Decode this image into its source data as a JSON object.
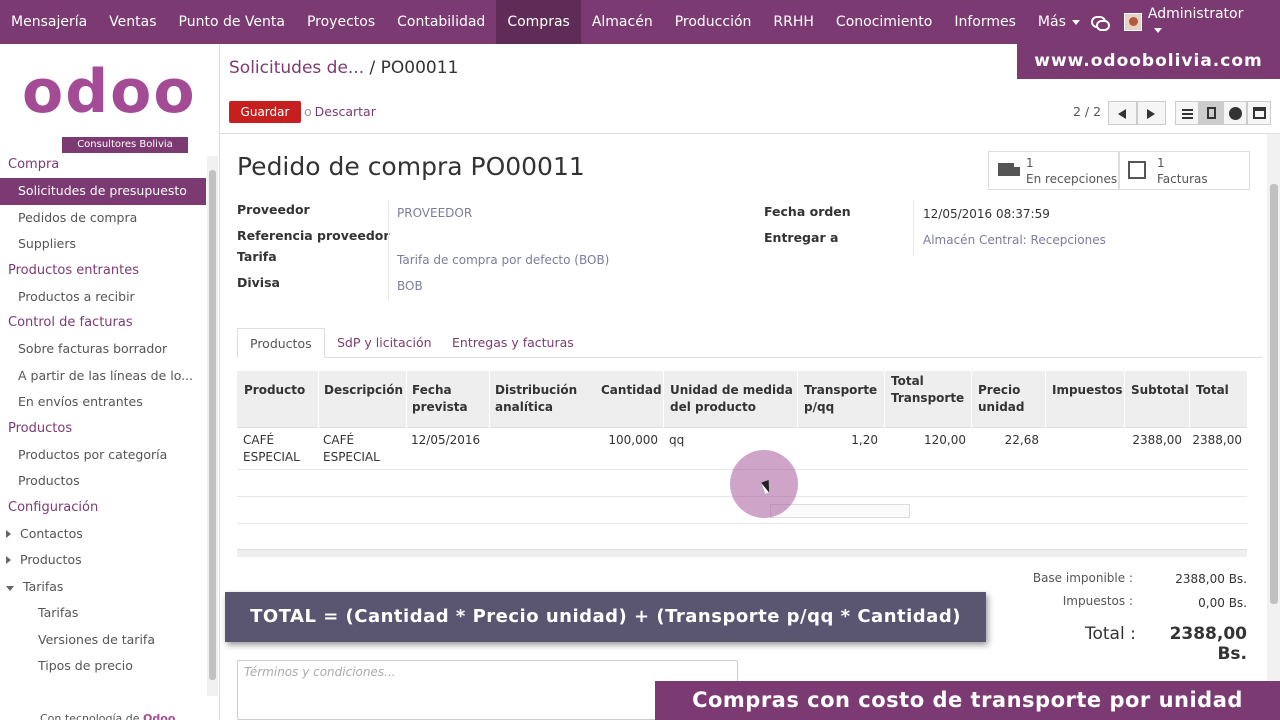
{
  "topnav": {
    "items": [
      "Mensajería",
      "Ventas",
      "Punto de Venta",
      "Proyectos",
      "Contabilidad",
      "Compras",
      "Almacén",
      "Producción",
      "RRHH",
      "Conocimiento",
      "Informes",
      "Más"
    ],
    "active": "Compras",
    "user": "Administrator"
  },
  "logo": {
    "word": "odoo",
    "subtitle": "Consultores Bolivia"
  },
  "sidebar": {
    "sections": [
      {
        "title": "Compra",
        "items": [
          "Solicitudes de presupuesto",
          "Pedidos de compra",
          "Suppliers"
        ]
      },
      {
        "title": "Productos entrantes",
        "items": [
          "Productos a recibir"
        ]
      },
      {
        "title": "Control de facturas",
        "items": [
          "Sobre facturas borrador",
          "A partir de las líneas de lo...",
          "En envíos entrantes"
        ]
      },
      {
        "title": "Productos",
        "items": [
          "Productos por categoría",
          "Productos"
        ]
      },
      {
        "title": "Configuración",
        "items": [
          "Contactos",
          "Productos",
          "Tarifas",
          "Tarifas",
          "Versiones de tarifa",
          "Tipos de precio"
        ]
      }
    ],
    "active_item": "Solicitudes de presupuesto",
    "powered_prefix": "Con tecnología de",
    "powered_brand": "Odoo"
  },
  "breadcrumb": {
    "parent": "Solicitudes de...",
    "separator": "/",
    "current": "PO00011"
  },
  "buttons": {
    "save": "Guardar",
    "or": "o",
    "discard": "Descartar"
  },
  "pager": {
    "text": "2 / 2"
  },
  "banners": {
    "site": "www.odoobolivia.com",
    "bottom": "Compras con costo de transporte por unidad",
    "formula": "TOTAL = (Cantidad * Precio unidad) + (Transporte p/qq * Cantidad)"
  },
  "form": {
    "title": "Pedido de compra PO00011",
    "smart_buttons": [
      {
        "count": "1",
        "label": "En recepciones",
        "icon": "truck-icon"
      },
      {
        "count": "1",
        "label": "Facturas",
        "icon": "edit-icon"
      }
    ],
    "left_fields": {
      "proveedor_label": "Proveedor",
      "proveedor_value": "PROVEEDOR",
      "referencia_label": "Referencia proveedor",
      "tarifa_label": "Tarifa",
      "tarifa_value": "Tarifa de compra por defecto (BOB)",
      "divisa_label": "Divisa",
      "divisa_value": "BOB"
    },
    "right_fields": {
      "fecha_label": "Fecha orden",
      "fecha_value": "12/05/2016 08:37:59",
      "entregar_label": "Entregar a",
      "entregar_value": "Almacén Central: Recepciones"
    },
    "tabs": [
      "Productos",
      "SdP y licitación",
      "Entregas y facturas"
    ],
    "table": {
      "headers": {
        "producto": "Producto",
        "descripcion": "Descripción",
        "fecha1": "Fecha",
        "fecha2": "prevista",
        "dist1": "Distribución",
        "dist2": "analítica",
        "cantidad": "Cantidad",
        "uom1": "Unidad de medida",
        "uom2": "del producto",
        "transp1": "Transporte",
        "transp2": "p/qq",
        "ttransp1": "Total",
        "ttransp2": "Transporte",
        "precio1": "Precio",
        "precio2": "unidad",
        "impuestos": "Impuestos",
        "subtotal": "Subtotal",
        "total": "Total"
      },
      "row": {
        "producto1": "CAFÉ",
        "producto2": "ESPECIAL",
        "descripcion1": "CAFÉ",
        "descripcion2": "ESPECIAL",
        "fecha": "12/05/2016",
        "cantidad": "100,000",
        "uom": "qq",
        "transporte": "1,20",
        "total_transporte": "120,00",
        "precio": "22,68",
        "subtotal": "2388,00",
        "total": "2388,00"
      }
    },
    "totals": {
      "base_label": "Base imponible :",
      "base_value": "2388,00 Bs.",
      "impuestos_label": "Impuestos :",
      "impuestos_value": "0,00 Bs.",
      "total_label": "Total :",
      "total_value": "2388,00 Bs."
    },
    "terms_placeholder": "Términos y condiciones..."
  }
}
